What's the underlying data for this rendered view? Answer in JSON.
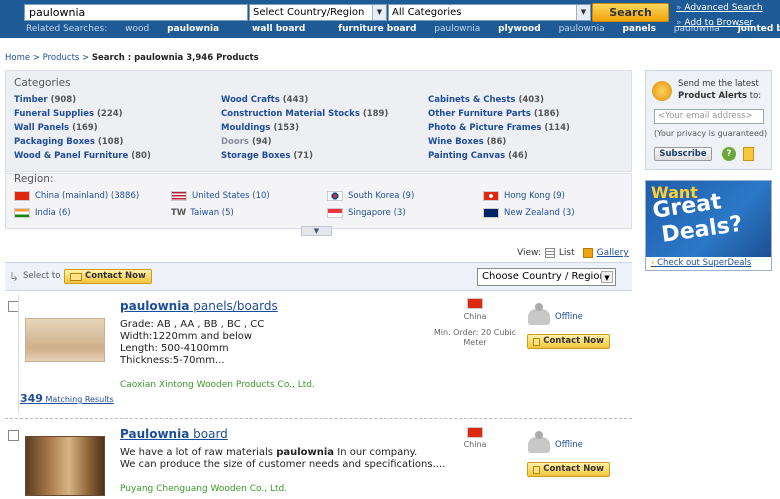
{
  "search": {
    "query": "paulownia",
    "country_select": "Select Country/Region",
    "category_select": "All Categories",
    "button": "Search"
  },
  "related": {
    "label": "Related Searches:",
    "items": [
      {
        "pre": "wood ",
        "bold": "paulownia",
        "post": ""
      },
      {
        "pre": "",
        "bold": "wall board",
        "post": ""
      },
      {
        "pre": "",
        "bold": "furniture board",
        "post": ""
      },
      {
        "pre": "paulownia ",
        "bold": "plywood",
        "post": ""
      },
      {
        "pre": "paulownia ",
        "bold": "panels",
        "post": ""
      },
      {
        "pre": "paulownia ",
        "bold": "jointed board",
        "post": ""
      }
    ]
  },
  "toplinks": {
    "advanced": "Advanced Search",
    "add_browser": "Add to Browser"
  },
  "breadcrumb": {
    "home": "Home",
    "sep": ">",
    "products": "Products",
    "current": "Search : paulownia 3,946 Products"
  },
  "categories": {
    "title": "Categories",
    "items": [
      {
        "name": "Timber",
        "count": "(908)"
      },
      {
        "name": "Wood Crafts",
        "count": "(443)"
      },
      {
        "name": "Cabinets & Chests",
        "count": "(403)"
      },
      {
        "name": "Funeral Supplies",
        "count": "(224)"
      },
      {
        "name": "Construction Material Stocks",
        "count": "(189)"
      },
      {
        "name": "Other Furniture Parts",
        "count": "(186)"
      },
      {
        "name": "Wall Panels",
        "count": "(169)"
      },
      {
        "name": "Mouldings",
        "count": "(153)"
      },
      {
        "name": "Photo & Picture Frames",
        "count": "(114)"
      },
      {
        "name": "Packaging Boxes",
        "count": "(108)"
      },
      {
        "name": "Doors",
        "count": "(94)"
      },
      {
        "name": "Wine Boxes",
        "count": "(86)"
      },
      {
        "name": "Wood & Panel Furniture",
        "count": "(80)"
      },
      {
        "name": "Storage Boxes",
        "count": "(71)"
      },
      {
        "name": "Painting Canvas",
        "count": "(46)"
      }
    ]
  },
  "region": {
    "title": "Region:",
    "items": [
      {
        "name": "China (mainland)",
        "count": "(3886)",
        "flag": "#de2910"
      },
      {
        "name": "United States",
        "count": "(10)",
        "flag": "#b22234"
      },
      {
        "name": "South Korea",
        "count": "(9)",
        "flag": "#ffffff"
      },
      {
        "name": "Hong Kong",
        "count": "(9)",
        "flag": "#de2910"
      },
      {
        "name": "India",
        "count": "(6)",
        "flag": "#ff9933"
      },
      {
        "name": "Taiwan",
        "count": "(5)",
        "flag": "#ffffff",
        "code": "TW"
      },
      {
        "name": "Singapore",
        "count": "(3)",
        "flag": "#ef3340"
      },
      {
        "name": "New Zealand",
        "count": "(3)",
        "flag": "#012169"
      }
    ]
  },
  "view": {
    "label": "View:",
    "list": "List",
    "gallery": "Gallery"
  },
  "selectbar": {
    "select_to": "Select to",
    "contact": "Contact Now",
    "choose_country": "Choose Country / Region"
  },
  "products": [
    {
      "title_bold": "paulownia",
      "title_rest": " panels/boards",
      "desc": [
        "Grade: AB , AA , BB , BC , CC",
        "Width:1220mm and below",
        "Length: 500-4100mm",
        "Thickness:5-70mm..."
      ],
      "company": "Caoxian Xintong Wooden Products Co., Ltd.",
      "country": "China",
      "min_order": "Min. Order: 20 Cubic Meter",
      "status": "Offline",
      "contact": "Contact Now",
      "matching_count": "349",
      "matching_label": "Matching Results"
    },
    {
      "title_bold": "Paulownia",
      "title_rest": " board",
      "desc_line1_pre": "We have a lot of raw materials ",
      "desc_line1_bold": "paulownia",
      "desc_line1_post": " In our company.",
      "desc_line2": "We can produce the size of customer needs and specifications....",
      "company": "Puyang Chenguang Wooden Co., Ltd.",
      "country": "China",
      "status": "Offline",
      "contact": "Contact Now"
    }
  ],
  "alerts": {
    "line1": "Send me the latest",
    "line2": "Product Alerts",
    "line2_post": " to:",
    "email_placeholder": "<Your email address>",
    "privacy": "(Your privacy is guaranteed)",
    "subscribe": "Subscribe",
    "help": "?"
  },
  "deals": {
    "want": "Want",
    "great": "Great",
    "deals": "Deals?",
    "link": "Check out SuperDeals"
  },
  "colors": {
    "topbar": "#1d5a96",
    "link": "#1d4d9a",
    "company": "#3a9a28",
    "button": "#f4c43a"
  }
}
